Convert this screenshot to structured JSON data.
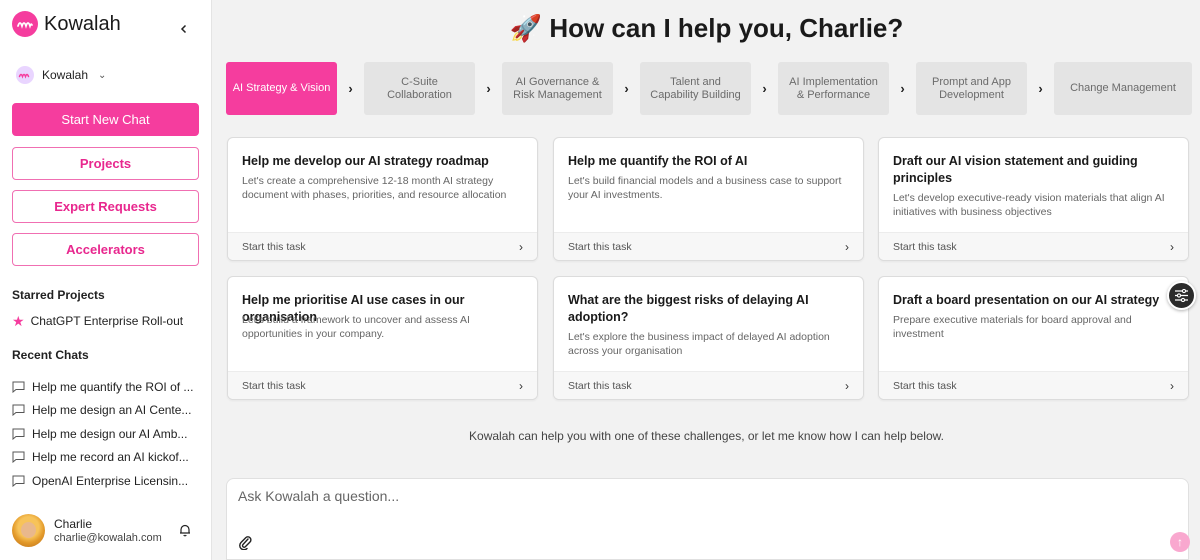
{
  "brand": {
    "name": "Kowalah",
    "color": "#f53d9e"
  },
  "workspace": {
    "name": "Kowalah"
  },
  "sidebar": {
    "new_chat": "Start New Chat",
    "projects": "Projects",
    "expert_requests": "Expert Requests",
    "accelerators": "Accelerators",
    "starred_title": "Starred Projects",
    "starred": [
      {
        "label": "ChatGPT Enterprise Roll-out",
        "icon": "star-icon"
      }
    ],
    "recent_title": "Recent Chats",
    "recent": [
      {
        "label": "Help me quantify the ROI of ..."
      },
      {
        "label": "Help me design an AI Cente..."
      },
      {
        "label": "Help me design our AI Amb..."
      },
      {
        "label": "Help me record an AI kickof..."
      },
      {
        "label": "OpenAI Enterprise Licensin..."
      }
    ]
  },
  "user": {
    "name": "Charlie",
    "email": "charlie@kowalah.com"
  },
  "hero": {
    "title": "🚀 How can I help you, Charlie?"
  },
  "steps": [
    {
      "label": "AI Strategy & Vision",
      "active": true
    },
    {
      "label": "C-Suite Collaboration",
      "active": false
    },
    {
      "label": "AI Governance & Risk Management",
      "active": false
    },
    {
      "label": "Talent and Capability Building",
      "active": false
    },
    {
      "label": "AI Implementation & Performance",
      "active": false
    },
    {
      "label": "Prompt and App Development",
      "active": false
    },
    {
      "label": "Change Management",
      "active": false
    }
  ],
  "cards": [
    {
      "title": "Help me develop our AI strategy roadmap",
      "desc": "Let's create a comprehensive 12-18 month AI strategy document with phases, priorities, and resource allocation",
      "action": "Start this task"
    },
    {
      "title": "Help me quantify the ROI of AI",
      "desc": "Let's build financial models and a business case to support your AI investments.",
      "action": "Start this task"
    },
    {
      "title": "Draft our AI vision statement and guiding principles",
      "desc": "Let's develop executive-ready vision materials that align AI initiatives with business objectives",
      "action": "Start this task"
    },
    {
      "title": "Help me prioritise AI use cases in our organisation",
      "desc": "Let's build a framework to uncover and assess AI opportunities in your company.",
      "action": "Start this task"
    },
    {
      "title": "What are the biggest risks of delaying AI adoption?",
      "desc": "Let's explore the business impact of delayed AI adoption across your organisation",
      "action": "Start this task"
    },
    {
      "title": "Draft a board presentation on our AI strategy",
      "desc": "Prepare executive materials for board approval and investment",
      "action": "Start this task"
    }
  ],
  "hint": "Kowalah can help you with one of these challenges, or let me know how I can help below.",
  "composer": {
    "placeholder": "Ask Kowalah a question..."
  }
}
